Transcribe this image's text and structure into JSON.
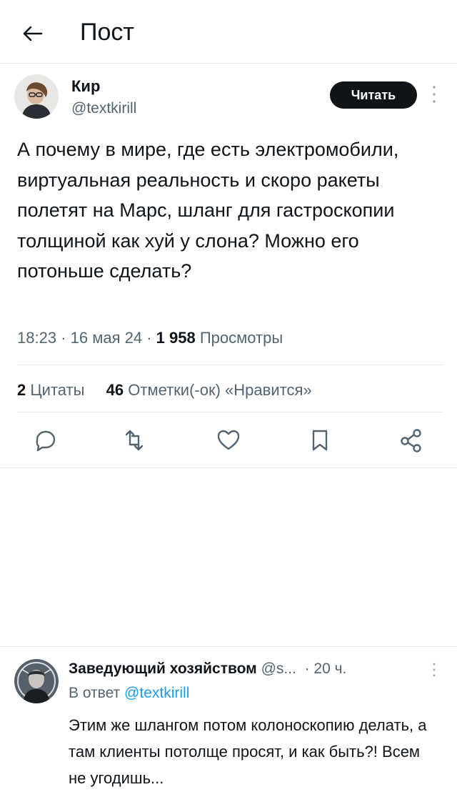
{
  "header": {
    "title": "Пост",
    "back_icon": "arrow-left-icon"
  },
  "tweet": {
    "author_name": "Кир",
    "author_handle": "@textkirill",
    "follow_label": "Читать",
    "more_icon": "more-vertical-icon",
    "text": "А почему в мире, где есть электромобили, виртуальная реальность и скоро ракеты полетят на Марс, шланг для гастроскопии толщиной как хуй у слона? Можно его потоньше сделать?",
    "time": "18:23",
    "date": "16 мая 24",
    "views_count": "1 958",
    "views_label": "Просмотры",
    "quotes_count": "2",
    "quotes_label": "Цитаты",
    "likes_count": "46",
    "likes_label": "Отметки(-ок) «Нравится»",
    "actions": [
      "reply-icon",
      "retweet-icon",
      "like-icon",
      "bookmark-icon",
      "share-icon"
    ]
  },
  "reply": {
    "author_name": "Заведующий хозяйством",
    "author_handle": "@s...",
    "time": "20 ч.",
    "reply_to_prefix": "В ответ",
    "reply_to_handle": "@textkirill",
    "text": "Этим же шлангом потом колоноскопию делать, а там клиенты потолще просят, и как быть?! Всем не угодишь..."
  },
  "colors": {
    "text": "#0f1419",
    "secondary": "#536471",
    "divider": "#e6ecf0",
    "button": "#0f1419"
  }
}
